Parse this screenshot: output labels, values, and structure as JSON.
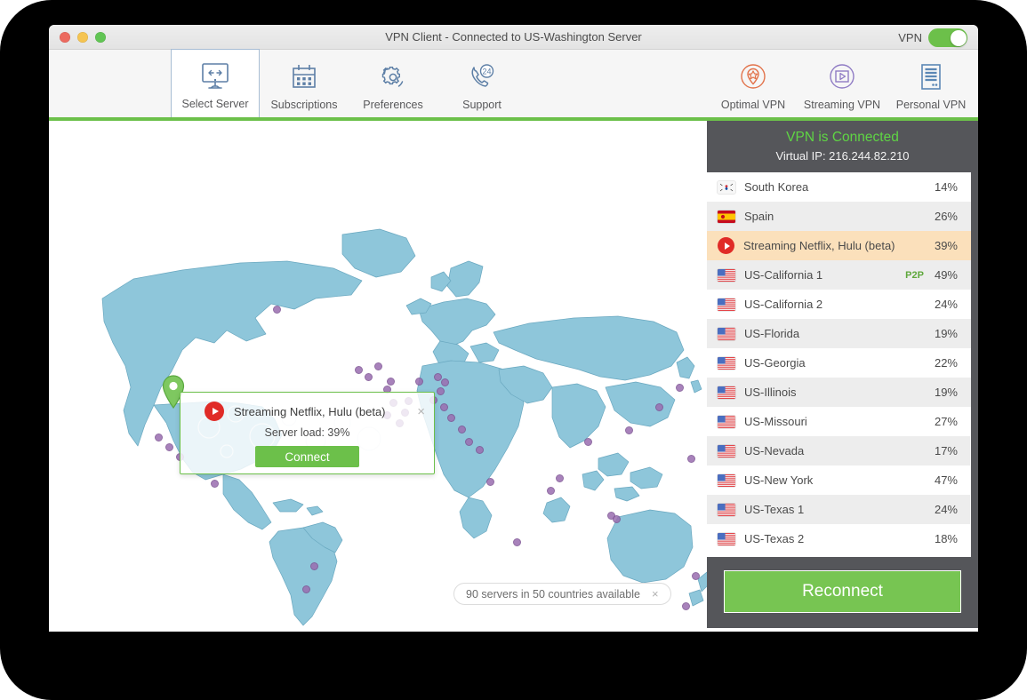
{
  "window": {
    "title": "VPN Client - Connected to US-Washington Server",
    "vpn_switch_label": "VPN",
    "vpn_switch_state": "on"
  },
  "toolbar": {
    "left_items": [
      {
        "label": "Select Server",
        "icon": "monitor-arrows-icon",
        "selected": true
      },
      {
        "label": "Subscriptions",
        "icon": "calendar-icon",
        "selected": false
      },
      {
        "label": "Preferences",
        "icon": "gear-icon",
        "selected": false
      },
      {
        "label": "Support",
        "icon": "phone-24-icon",
        "selected": false
      }
    ],
    "right_items": [
      {
        "label": "Optimal VPN",
        "icon": "star-pin-circle-icon",
        "color": "#e2724a"
      },
      {
        "label": "Streaming VPN",
        "icon": "play-circle-icon",
        "color": "#8f7bc4"
      },
      {
        "label": "Personal VPN",
        "icon": "server-list-icon",
        "color": "#5b87b5"
      }
    ],
    "accent_bar_color": "#6cc04a"
  },
  "map": {
    "pin_label": "US-Washington",
    "pill": {
      "text": "90 servers in 50 countries available",
      "close": "×"
    },
    "popup": {
      "title": "Streaming Netflix, Hulu (beta)",
      "server_load": "Server load: 39%",
      "connect_label": "Connect",
      "close": "×",
      "icon": "red-play-icon"
    },
    "land_color": "#8ec6da",
    "node_color": "#9a6db0"
  },
  "panel": {
    "status_title": "VPN is Connected",
    "status_ip": "Virtual IP: 216.244.82.210",
    "status_color": "#5fd544",
    "reconnect_label": "Reconnect",
    "servers": [
      {
        "name": "South Korea",
        "load": "14%",
        "flag": "kr",
        "badge": "",
        "selected": false
      },
      {
        "name": "Spain",
        "load": "26%",
        "flag": "es",
        "badge": "",
        "selected": false
      },
      {
        "name": "Streaming Netflix, Hulu (beta)",
        "load": "39%",
        "flag": "play",
        "badge": "",
        "selected": true
      },
      {
        "name": "US-California 1",
        "load": "49%",
        "flag": "us",
        "badge": "P2P",
        "selected": false
      },
      {
        "name": "US-California 2",
        "load": "24%",
        "flag": "us",
        "badge": "",
        "selected": false
      },
      {
        "name": "US-Florida",
        "load": "19%",
        "flag": "us",
        "badge": "",
        "selected": false
      },
      {
        "name": "US-Georgia",
        "load": "22%",
        "flag": "us",
        "badge": "",
        "selected": false
      },
      {
        "name": "US-Illinois",
        "load": "19%",
        "flag": "us",
        "badge": "",
        "selected": false
      },
      {
        "name": "US-Missouri",
        "load": "27%",
        "flag": "us",
        "badge": "",
        "selected": false
      },
      {
        "name": "US-Nevada",
        "load": "17%",
        "flag": "us",
        "badge": "",
        "selected": false
      },
      {
        "name": "US-New York",
        "load": "47%",
        "flag": "us",
        "badge": "",
        "selected": false
      },
      {
        "name": "US-Texas 1",
        "load": "24%",
        "flag": "us",
        "badge": "",
        "selected": false
      },
      {
        "name": "US-Texas 2",
        "load": "18%",
        "flag": "us",
        "badge": "",
        "selected": false
      }
    ]
  }
}
